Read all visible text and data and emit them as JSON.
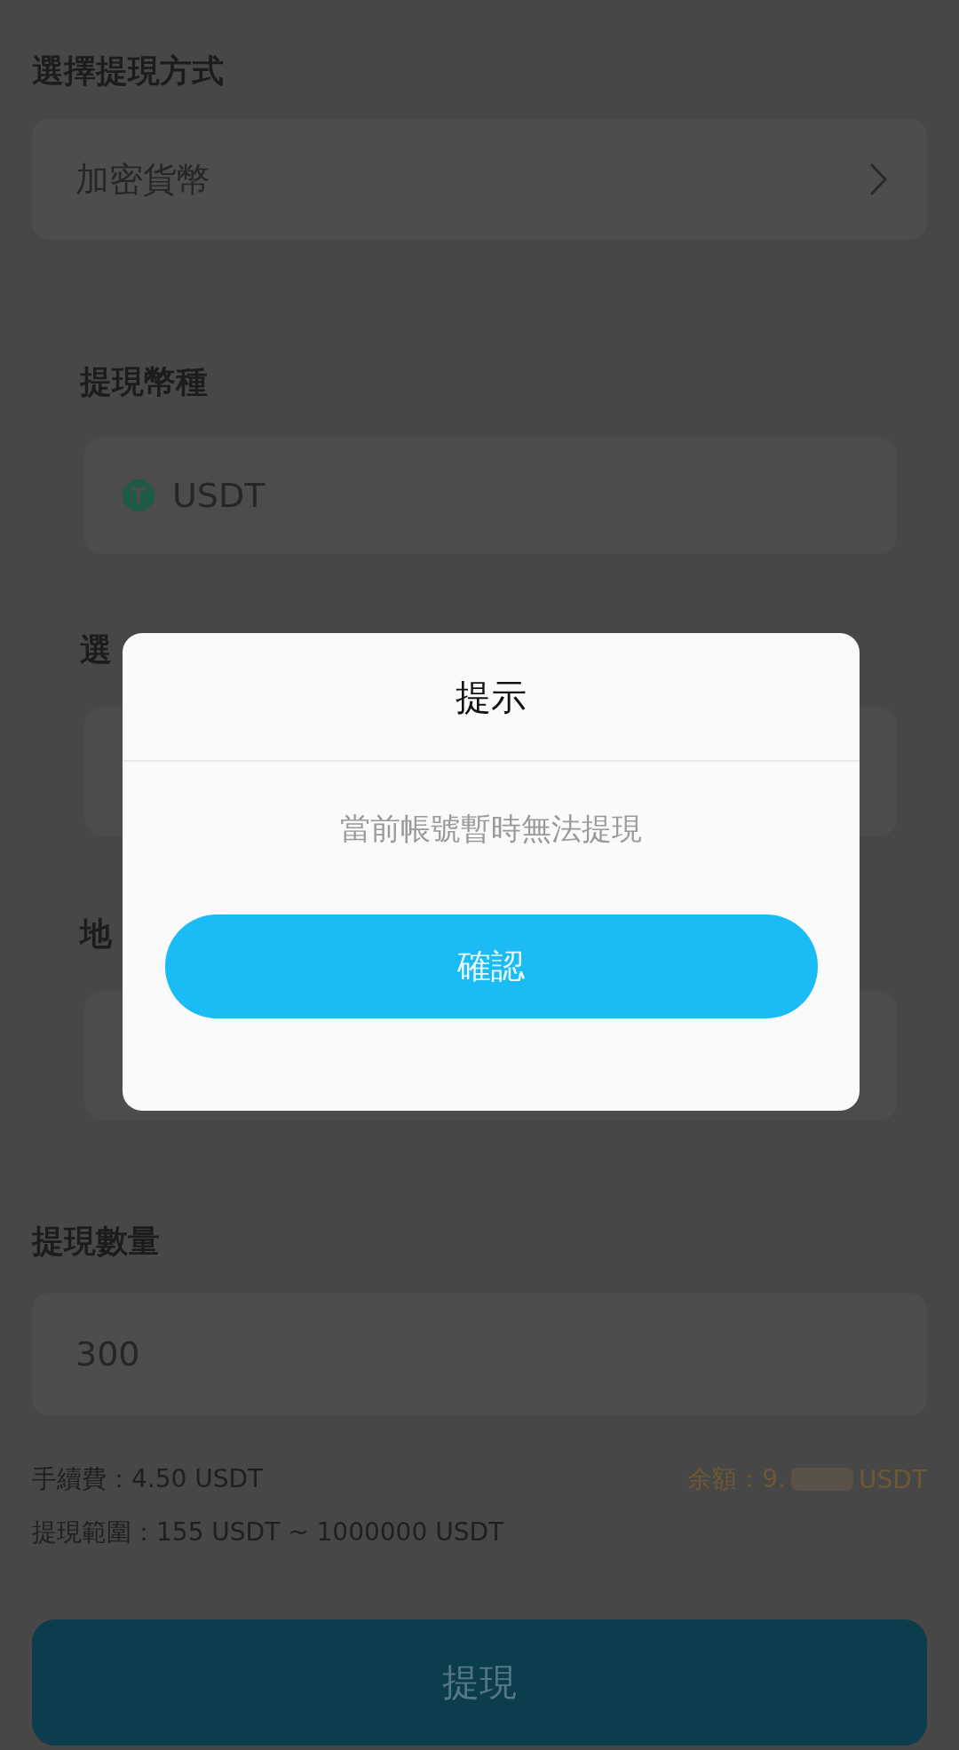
{
  "withdraw_method": {
    "label": "選擇提現方式",
    "value": "加密貨幣"
  },
  "currency": {
    "label": "提現幣種",
    "value": "USDT"
  },
  "network": {
    "label": "選"
  },
  "address": {
    "label": "地"
  },
  "amount": {
    "label": "提現數量",
    "value": "300"
  },
  "fee": "手續費：4.50 USDT",
  "balance": {
    "prefix": "余額：9.",
    "suffix": "USDT"
  },
  "range": "提現範圍：155 USDT ~ 1000000 USDT",
  "submit_button": "提現",
  "dialog": {
    "title": "提示",
    "message": "當前帳號暫時無法提現",
    "confirm_button": "確認"
  }
}
